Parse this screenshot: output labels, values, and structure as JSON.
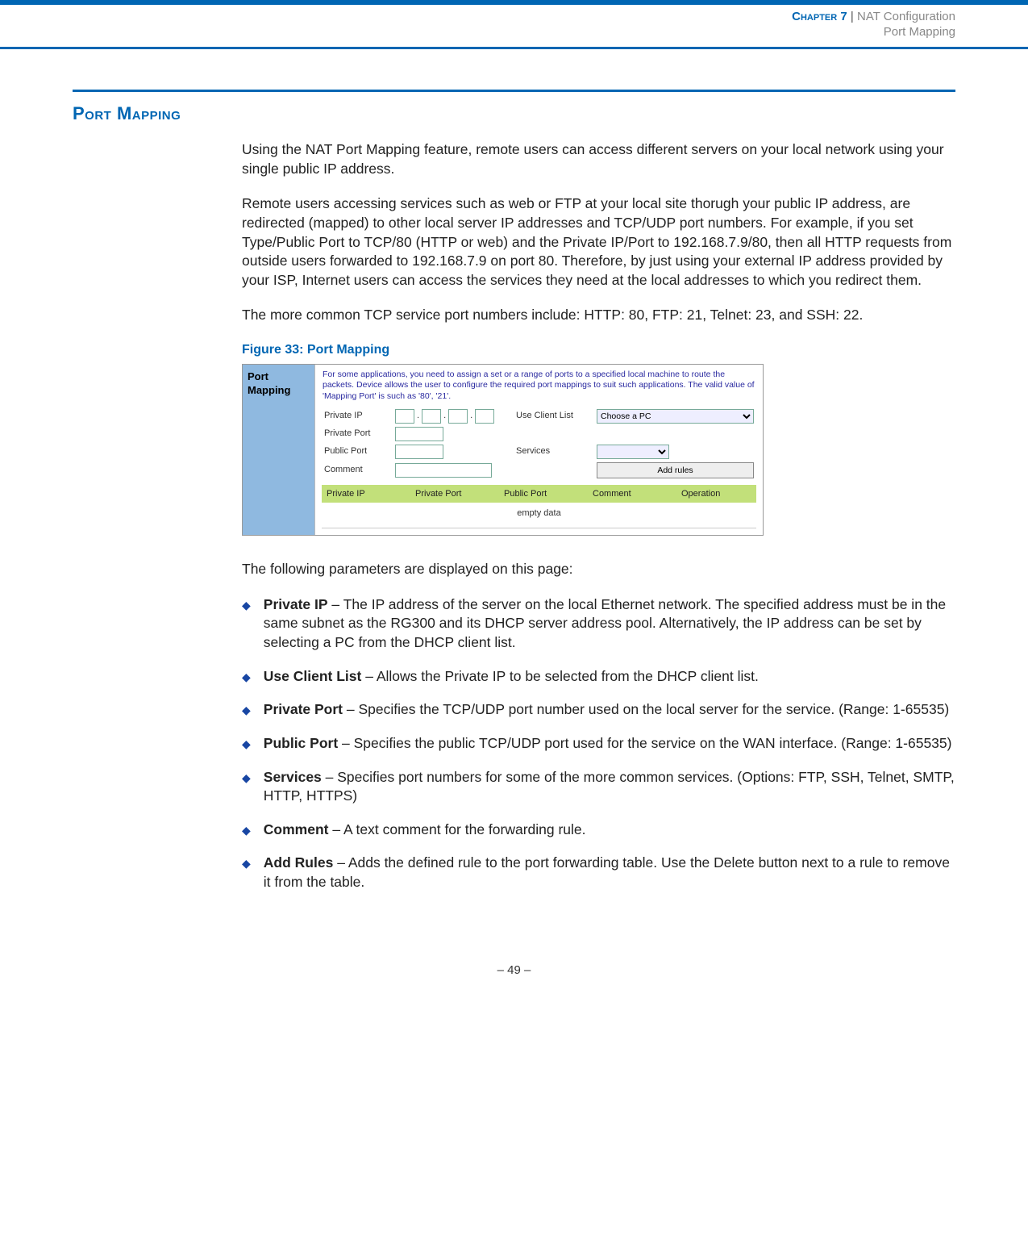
{
  "header": {
    "chapter": "Chapter 7",
    "separator": "|",
    "category": "NAT Configuration",
    "subtitle": "Port Mapping"
  },
  "section_title": "Port Mapping",
  "paragraphs": {
    "p1": "Using the NAT Port Mapping feature, remote users can access different servers on your local network using your single public IP address.",
    "p2": "Remote users accessing services such as web or FTP at your local site thorugh your public IP address, are redirected (mapped) to other local server IP addresses and TCP/UDP port numbers. For example, if you set Type/Public Port to TCP/80 (HTTP or web) and the Private IP/Port to 192.168.7.9/80, then all HTTP requests from outside users forwarded to 192.168.7.9 on port 80. Therefore, by just using your external IP address provided by your ISP, Internet users can access the services they need at the local addresses to which you redirect them.",
    "p3": "The more common TCP service port numbers include: HTTP: 80, FTP: 21, Telnet: 23, and SSH: 22."
  },
  "figure_caption": "Figure 33:  Port Mapping",
  "screenshot": {
    "sidebar_title": "Port Mapping",
    "desc": "For some applications, you need to assign a set or a range of ports to a specified local machine to route the packets. Device allows the user to configure the required port mappings to suit such applications.\nThe valid value of 'Mapping Port' is such as '80', '21'.",
    "labels": {
      "private_ip": "Private IP",
      "private_port": "Private Port",
      "public_port": "Public Port",
      "comment": "Comment",
      "use_client_list": "Use Client List",
      "services": "Services"
    },
    "select_client": "Choose a PC",
    "btn_add": "Add rules",
    "thead": {
      "c1": "Private IP",
      "c2": "Private Port",
      "c3": "Public Port",
      "c4": "Comment",
      "c5": "Operation"
    },
    "empty": "empty data"
  },
  "params_intro": "The following parameters are displayed on this page:",
  "params": [
    {
      "name": "Private IP",
      "desc": " – The IP address of the server on the local Ethernet network. The specified address must be in the same subnet as the RG300 and its DHCP server address pool. Alternatively, the IP address can be set by selecting a PC from the DHCP client list."
    },
    {
      "name": "Use Client List",
      "desc": " – Allows the Private IP to be selected from the DHCP client list."
    },
    {
      "name": "Private Port",
      "desc": " – Specifies the TCP/UDP port number used on the local server for the service. (Range: 1-65535)"
    },
    {
      "name": "Public Port",
      "desc": " – Specifies the public TCP/UDP port used for the service on the WAN interface. (Range: 1-65535)"
    },
    {
      "name": "Services",
      "desc": " – Specifies port numbers for some of the more common services. (Options: FTP, SSH, Telnet, SMTP, HTTP, HTTPS)"
    },
    {
      "name": "Comment",
      "desc": " – A text comment for the forwarding rule."
    },
    {
      "name": "Add Rules",
      "desc": " – Adds the defined rule to the port forwarding table. Use the Delete button next to a rule to remove it from the table."
    }
  ],
  "footer": "–  49  –"
}
